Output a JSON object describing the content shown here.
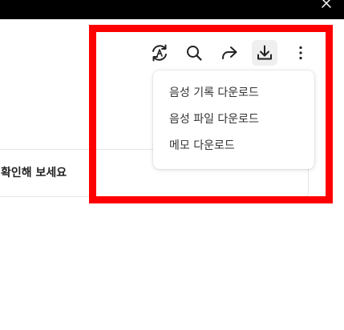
{
  "window": {
    "close_icon": "close-icon"
  },
  "toolbar": {
    "icons": [
      "translate-icon",
      "search-icon",
      "share-icon",
      "download-icon",
      "more-vertical-icon"
    ],
    "active": "download-icon"
  },
  "download_menu": {
    "items": [
      "음성 기록 다운로드",
      "음성 파일 다운로드",
      "메모 다운로드"
    ]
  },
  "card": {
    "text": "확인해 보세요"
  },
  "colors": {
    "highlight": "#ff0000",
    "top_bar": "#000000",
    "icon": "#222222"
  }
}
